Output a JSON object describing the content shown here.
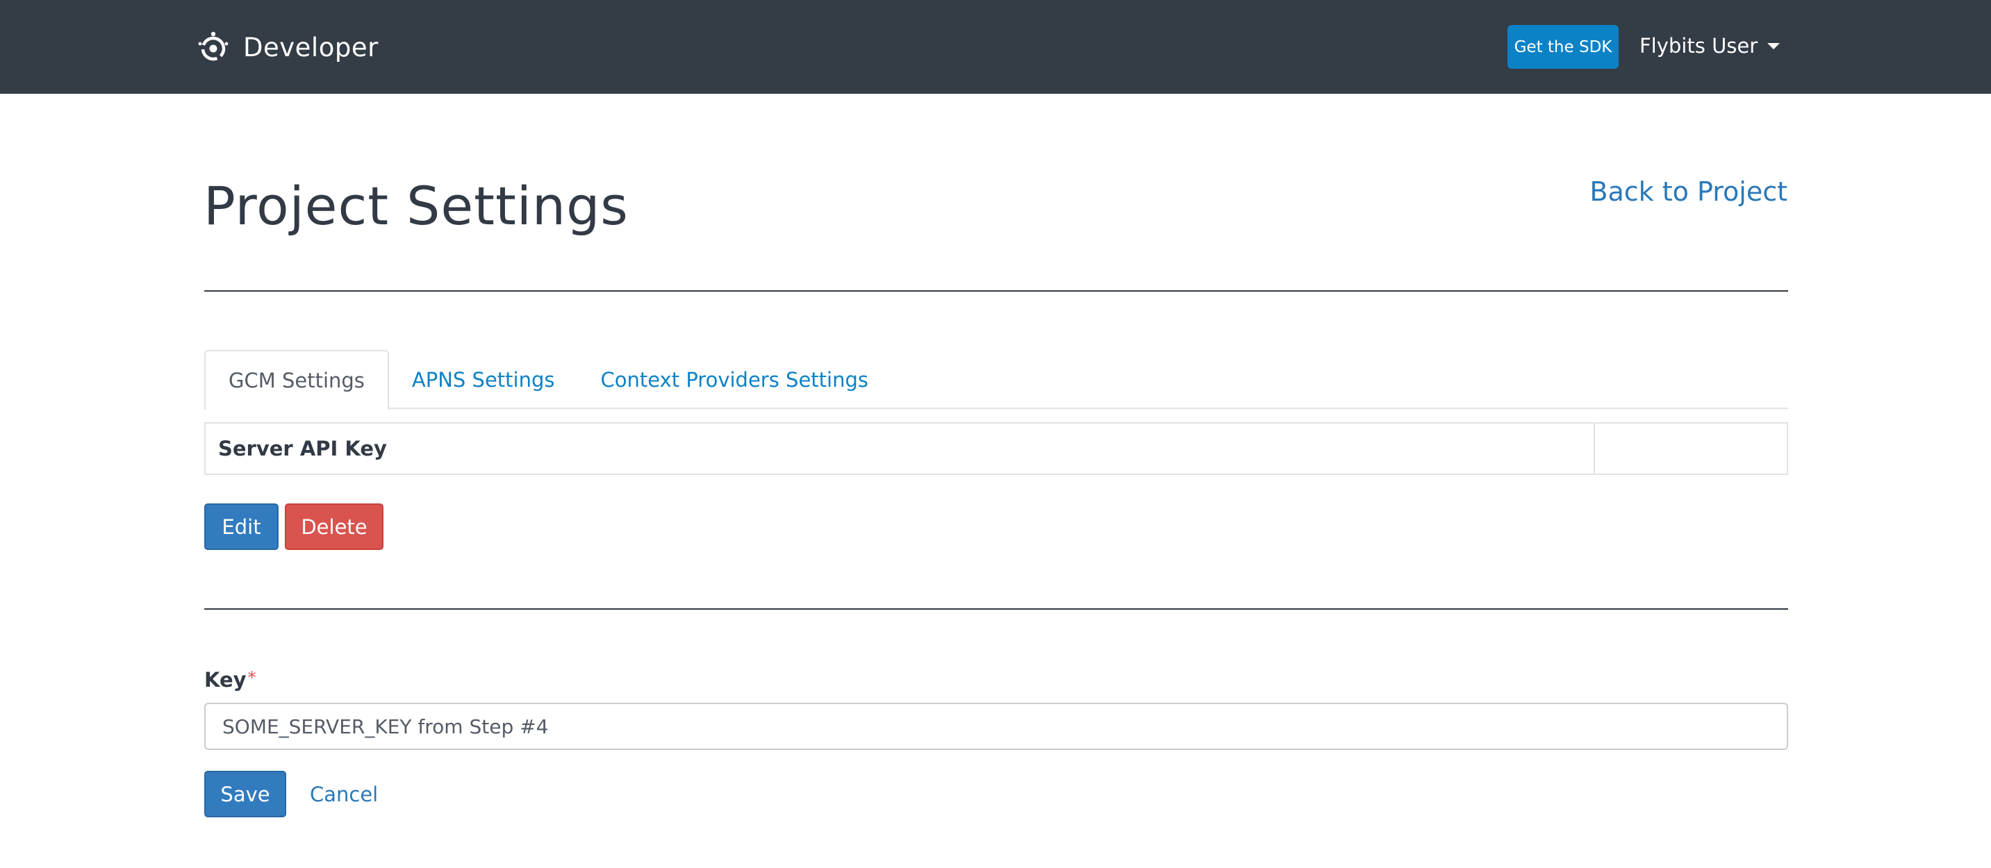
{
  "navbar": {
    "brand_name": "Developer",
    "brand_icon": "flybits-logo-icon",
    "sdk_button_label": "Get the SDK",
    "user_menu_label": "Flybits User",
    "user_menu_icon": "caret-down-icon",
    "background_color": "#343c46",
    "sdk_button_color": "#0c82c6"
  },
  "header": {
    "title": "Project Settings",
    "back_link_label": "Back to Project"
  },
  "tabs": [
    {
      "label": "GCM Settings",
      "active": true
    },
    {
      "label": "APNS Settings",
      "active": false
    },
    {
      "label": "Context Providers Settings",
      "active": false
    }
  ],
  "settings_table": {
    "rows": [
      {
        "key": "Server API Key",
        "value": ""
      }
    ]
  },
  "actions": {
    "edit_label": "Edit",
    "delete_label": "Delete",
    "primary_color": "#327bbf",
    "danger_color": "#d9534f"
  },
  "form": {
    "key_label": "Key",
    "required_marker": "*",
    "key_value": "SOME_SERVER_KEY from Step #4",
    "save_label": "Save",
    "cancel_label": "Cancel"
  }
}
